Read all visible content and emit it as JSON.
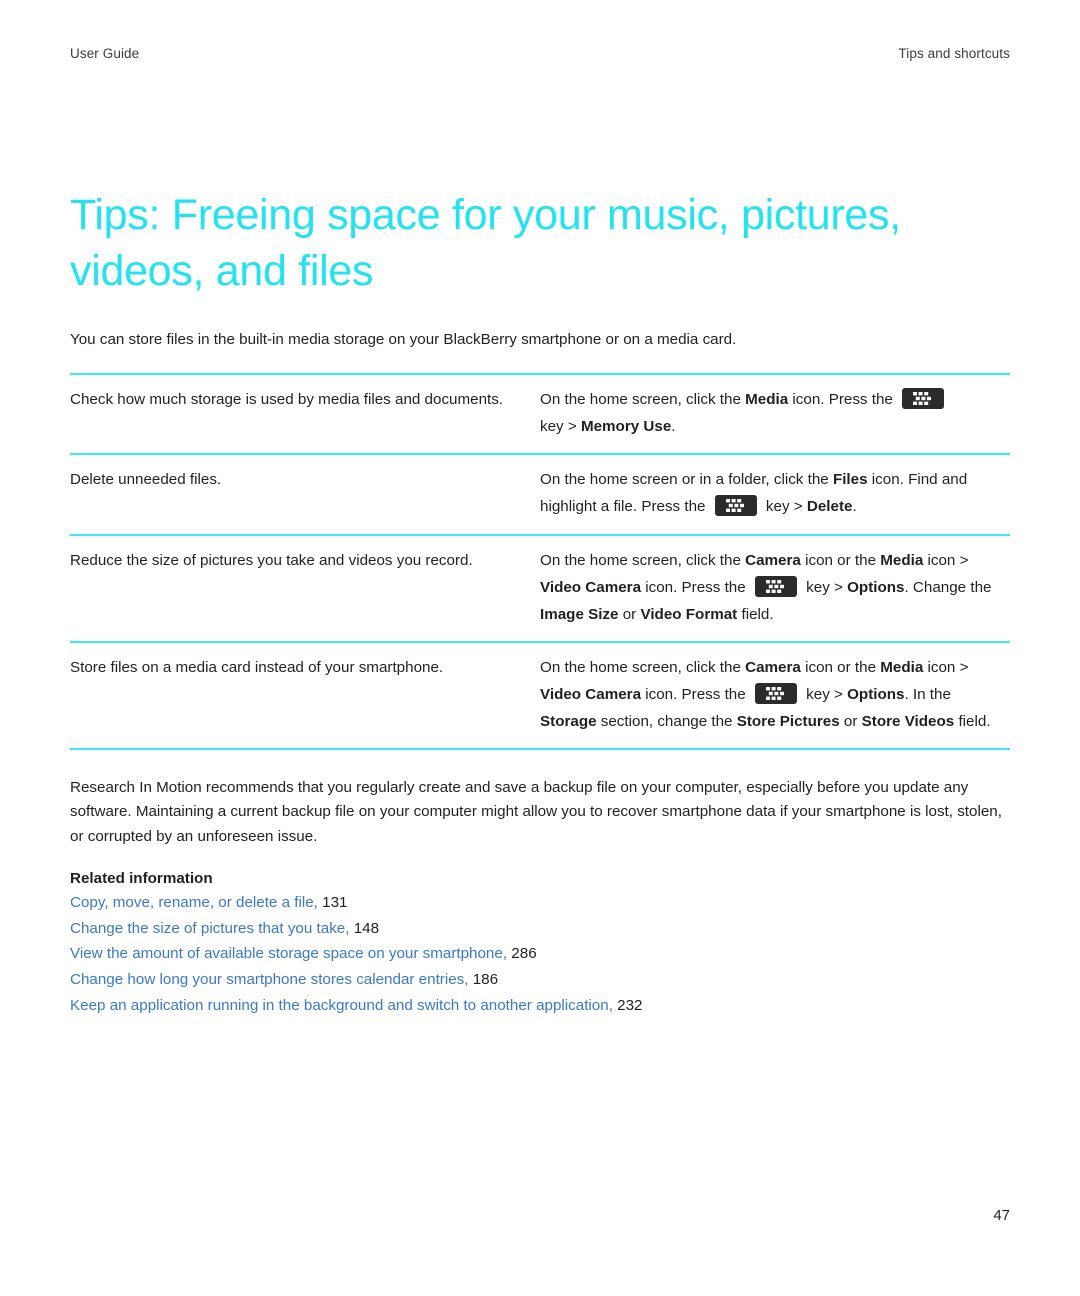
{
  "header": {
    "left": "User Guide",
    "right": "Tips and shortcuts"
  },
  "title": "Tips: Freeing space for your music, pictures, videos, and files",
  "intro": "You can store files in the built-in media storage on your BlackBerry smartphone or on a media card.",
  "table": {
    "rows": [
      {
        "task": "Check how much storage is used by media files and documents.",
        "action": {
          "p1_a": "On the home screen, click the ",
          "p1_b": "Media",
          "p1_c": " icon. Press the ",
          "icon": "blackberry-menu-key-icon",
          "p2_a": "key > ",
          "p2_b": "Memory Use",
          "p2_c": "."
        }
      },
      {
        "task": "Delete unneeded files.",
        "action": {
          "p1_a": "On the home screen or in a folder, click the ",
          "p1_b": "Files",
          "p1_c": " icon. Find and highlight a file. Press the ",
          "icon": "blackberry-menu-key-icon",
          "p2_a": " key > ",
          "p2_b": "Delete",
          "p2_c": "."
        }
      },
      {
        "task": "Reduce the size of pictures you take and videos you record.",
        "action": {
          "p1_a": "On the home screen, click the ",
          "p1_b": "Camera",
          "p1_c": " icon or the ",
          "p1_d": "Media",
          "p1_e": " icon > ",
          "p1_f": "Video Camera",
          "p1_g": " icon. Press the ",
          "icon": "blackberry-menu-key-icon",
          "p2_a": " key > ",
          "p2_b": "Options",
          "p2_c": ". Change the ",
          "p2_d": "Image Size",
          "p2_e": " or ",
          "p2_f": "Video Format",
          "p2_g": " field."
        }
      },
      {
        "task": "Store files on a media card instead of your smartphone.",
        "action": {
          "p1_a": "On the home screen, click the ",
          "p1_b": "Camera",
          "p1_c": " icon or the ",
          "p1_d": "Media",
          "p1_e": " icon > ",
          "p1_f": "Video Camera",
          "p1_g": " icon. Press the ",
          "icon": "blackberry-menu-key-icon",
          "p2_a": " key > ",
          "p2_b": "Options",
          "p2_c": ". In the ",
          "p2_d": "Storage",
          "p2_e": " section, change the ",
          "p2_f": "Store Pictures",
          "p2_g": " or ",
          "p2_h": "Store Videos",
          "p2_i": " field."
        }
      }
    ]
  },
  "closing": "Research In Motion recommends that you regularly create and save a backup file on your computer, especially before you update any software. Maintaining a current backup file on your computer might allow you to recover smartphone data if your smartphone is lost, stolen, or corrupted by an unforeseen issue.",
  "related": {
    "title": "Related information",
    "links": [
      {
        "text": "Copy, move, rename, or delete a file,",
        "page": "131"
      },
      {
        "text": "Change the size of pictures that you take,",
        "page": "148"
      },
      {
        "text": "View the amount of available storage space on your smartphone,",
        "page": "286"
      },
      {
        "text": "Change how long your smartphone stores calendar entries,",
        "page": "186"
      },
      {
        "text": "Keep an application running in the background and switch to another application,",
        "page": "232"
      }
    ]
  },
  "folio": "47",
  "colors": {
    "accent_cyan": "#22e4f0",
    "rule_cyan": "#3ce9f5",
    "link_blue": "#3b78c8",
    "body_text": "#231f20",
    "key_icon_bg": "#2b2b2b"
  }
}
